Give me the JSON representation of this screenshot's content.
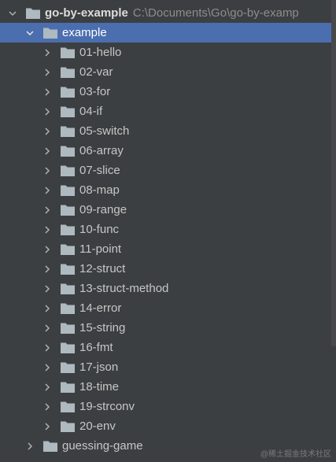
{
  "project_tree": {
    "root": {
      "name": "go-by-example",
      "path": "C:\\Documents\\Go\\go-by-examp",
      "expanded": true
    },
    "example": {
      "name": "example",
      "expanded": true,
      "selected": true
    },
    "children": [
      {
        "name": "01-hello"
      },
      {
        "name": "02-var"
      },
      {
        "name": "03-for"
      },
      {
        "name": "04-if"
      },
      {
        "name": "05-switch"
      },
      {
        "name": "06-array"
      },
      {
        "name": "07-slice"
      },
      {
        "name": "08-map"
      },
      {
        "name": "09-range"
      },
      {
        "name": "10-func"
      },
      {
        "name": "11-point"
      },
      {
        "name": "12-struct"
      },
      {
        "name": "13-struct-method"
      },
      {
        "name": "14-error"
      },
      {
        "name": "15-string"
      },
      {
        "name": "16-fmt"
      },
      {
        "name": "17-json"
      },
      {
        "name": "18-time"
      },
      {
        "name": "19-strconv"
      },
      {
        "name": "20-env"
      }
    ],
    "sibling": {
      "name": "guessing-game",
      "expanded": false
    }
  },
  "watermark": "@稀土掘金技术社区",
  "icons": {
    "folder": "folder-icon",
    "expanded": "chevron-down-icon",
    "collapsed": "chevron-right-icon"
  },
  "colors": {
    "background": "#3c3f41",
    "selection": "#4b6eaf",
    "folder": "#aeb9c0",
    "text": "#c6c6c6",
    "path_text": "#8c8c8c"
  }
}
